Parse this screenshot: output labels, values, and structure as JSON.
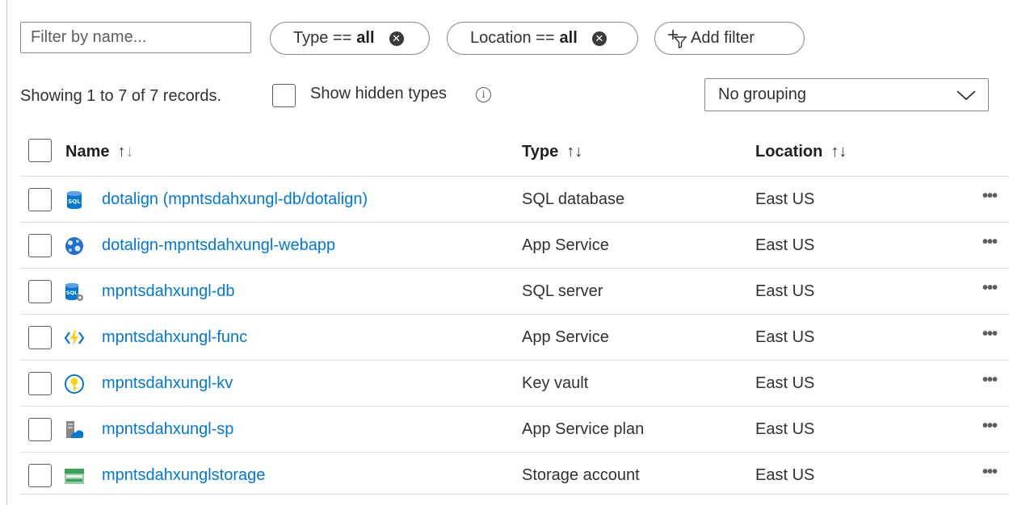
{
  "filter": {
    "name_placeholder": "Filter by name...",
    "pills": [
      {
        "label": "Type ==",
        "value": "all"
      },
      {
        "label": "Location ==",
        "value": "all"
      }
    ],
    "add_filter_label": "Add filter"
  },
  "summary": {
    "records_text": "Showing 1 to 7 of 7 records.",
    "show_hidden_label": "Show hidden types",
    "grouping_value": "No grouping"
  },
  "table": {
    "headers": {
      "name": "Name",
      "type": "Type",
      "location": "Location"
    },
    "rows": [
      {
        "name": "dotalign (mpntsdahxungl-db/dotalign)",
        "type": "SQL database",
        "location": "East US",
        "icon": "sql-database-icon"
      },
      {
        "name": "dotalign-mpntsdahxungl-webapp",
        "type": "App Service",
        "location": "East US",
        "icon": "app-service-icon"
      },
      {
        "name": "mpntsdahxungl-db",
        "type": "SQL server",
        "location": "East US",
        "icon": "sql-server-icon"
      },
      {
        "name": "mpntsdahxungl-func",
        "type": "App Service",
        "location": "East US",
        "icon": "function-app-icon"
      },
      {
        "name": "mpntsdahxungl-kv",
        "type": "Key vault",
        "location": "East US",
        "icon": "key-vault-icon"
      },
      {
        "name": "mpntsdahxungl-sp",
        "type": "App Service plan",
        "location": "East US",
        "icon": "app-service-plan-icon"
      },
      {
        "name": "mpntsdahxunglstorage",
        "type": "Storage account",
        "location": "East US",
        "icon": "storage-account-icon"
      }
    ]
  },
  "colors": {
    "link": "#0078d4",
    "border": "#8a8886"
  }
}
